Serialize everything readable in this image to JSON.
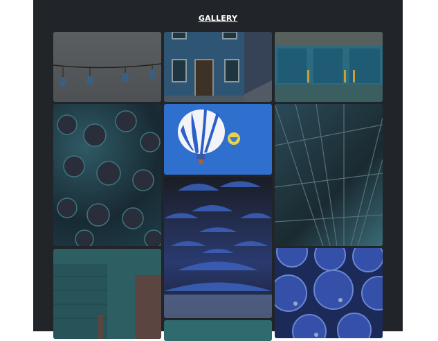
{
  "header": {
    "title": "GALLERY"
  },
  "colors": {
    "background": "#212428",
    "title": "#ffffff"
  }
}
